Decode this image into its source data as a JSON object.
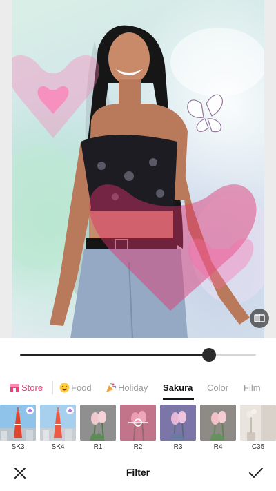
{
  "editor": {
    "compare_icon": "compare-icon",
    "intensity": 0.8
  },
  "categories": [
    {
      "label": "Store",
      "icon": "store-icon",
      "active": false
    },
    {
      "label": "Food",
      "icon": "emoji-face-icon",
      "active": false
    },
    {
      "label": "Holiday",
      "icon": "party-popper-icon",
      "active": false
    },
    {
      "label": "Sakura",
      "icon": "",
      "active": true
    },
    {
      "label": "Color",
      "icon": "",
      "active": false
    },
    {
      "label": "Film",
      "icon": "",
      "active": false
    }
  ],
  "filters": [
    {
      "label": "SK3",
      "selected": false,
      "locked": true
    },
    {
      "label": "SK4",
      "selected": false,
      "locked": true
    },
    {
      "label": "R1",
      "selected": false,
      "locked": false
    },
    {
      "label": "R2",
      "selected": true,
      "locked": false
    },
    {
      "label": "R3",
      "selected": false,
      "locked": false
    },
    {
      "label": "R4",
      "selected": false,
      "locked": false
    },
    {
      "label": "C35",
      "selected": false,
      "locked": false
    }
  ],
  "bottom_bar": {
    "title": "Filter",
    "close_icon": "close-icon",
    "confirm_icon": "checkmark-icon"
  },
  "colors": {
    "store_accent": "#e8407a",
    "active_tab": "#111111",
    "inactive_tab": "#9a9a9a",
    "slider_thumb": "#2b2b2b"
  }
}
